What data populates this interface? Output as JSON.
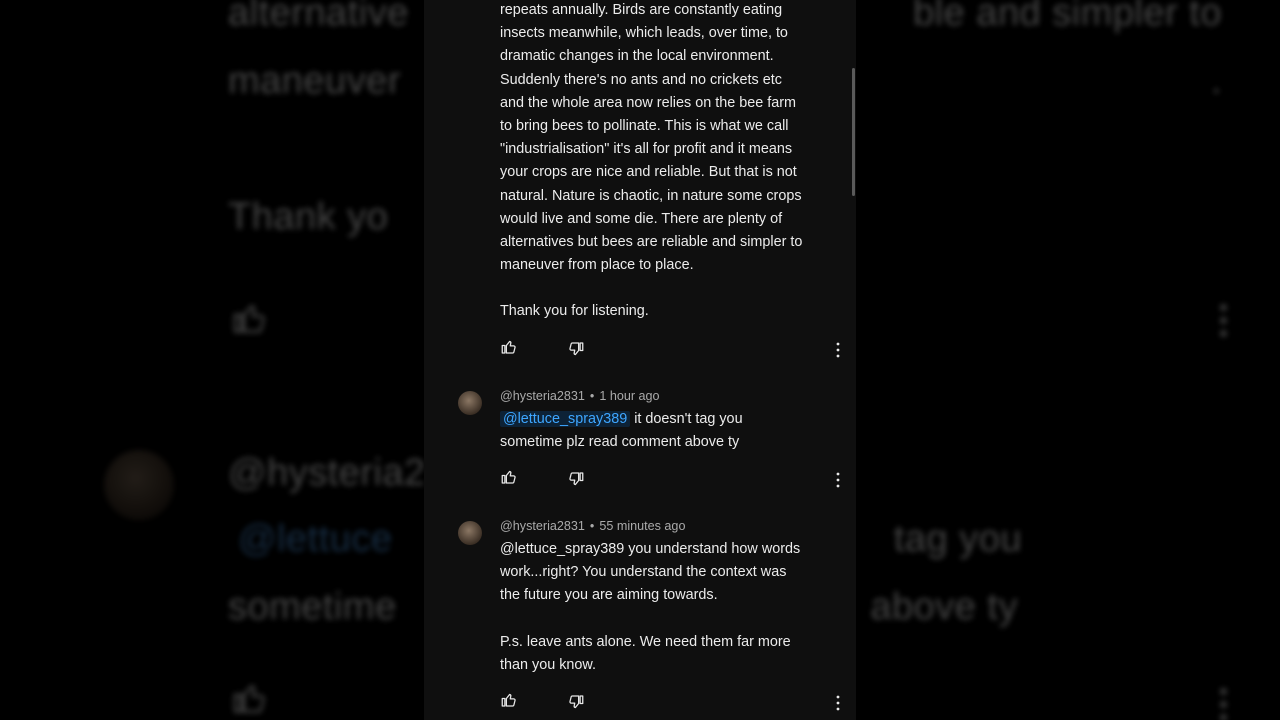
{
  "background": {
    "lines": [
      {
        "left": "alternative",
        "right": "ble and simpler to"
      },
      {
        "left": "maneuver",
        "right": "."
      },
      {
        "left": "Thank yo",
        "right": ""
      },
      {
        "left": "@hysteria2",
        "right": ""
      },
      {
        "left": "@lettuce",
        "right": "tag you"
      },
      {
        "left": "sometime",
        "right": "above ty"
      }
    ]
  },
  "top_comment": {
    "lines": [
      "repeats annually. Birds are constantly eating",
      "insects meanwhile, which leads, over time, to",
      "dramatic changes in the local environment.",
      "Suddenly there's no ants and no crickets etc",
      "and the whole area now relies on the bee farm",
      "to bring bees to pollinate. This is what we call",
      "\"industrialisation\" it's all for profit and it means",
      "your crops are nice and reliable. But that is not",
      "natural. Nature is chaotic, in nature some crops",
      "would live and some die. There are plenty of",
      "alternatives but bees are reliable and simpler to",
      "maneuver from place to place."
    ],
    "closing": "Thank you for listening."
  },
  "replies": [
    {
      "author": "@hysteria2831",
      "time": "1 hour ago",
      "mention": "@lettuce_spray389",
      "line1_rest": " it doesn't tag you",
      "line2": "sometime plz read comment above ty"
    },
    {
      "author": "@hysteria2831",
      "time": "55 minutes ago",
      "line1": "@lettuce_spray389  you understand how words",
      "line2": "work...right? You understand the context was",
      "line3": "the future you are aiming towards.",
      "ps1": "P.s. leave ants alone. We need them far more",
      "ps2": "than you know."
    }
  ],
  "icons": {
    "like": "thumbs-up-icon",
    "dislike": "thumbs-down-icon",
    "more": "more-vert-icon"
  },
  "colors": {
    "panel_bg": "#0f0f0f",
    "mention": "#3ea6ff",
    "meta": "#aaaaaa",
    "text": "#ececec"
  }
}
